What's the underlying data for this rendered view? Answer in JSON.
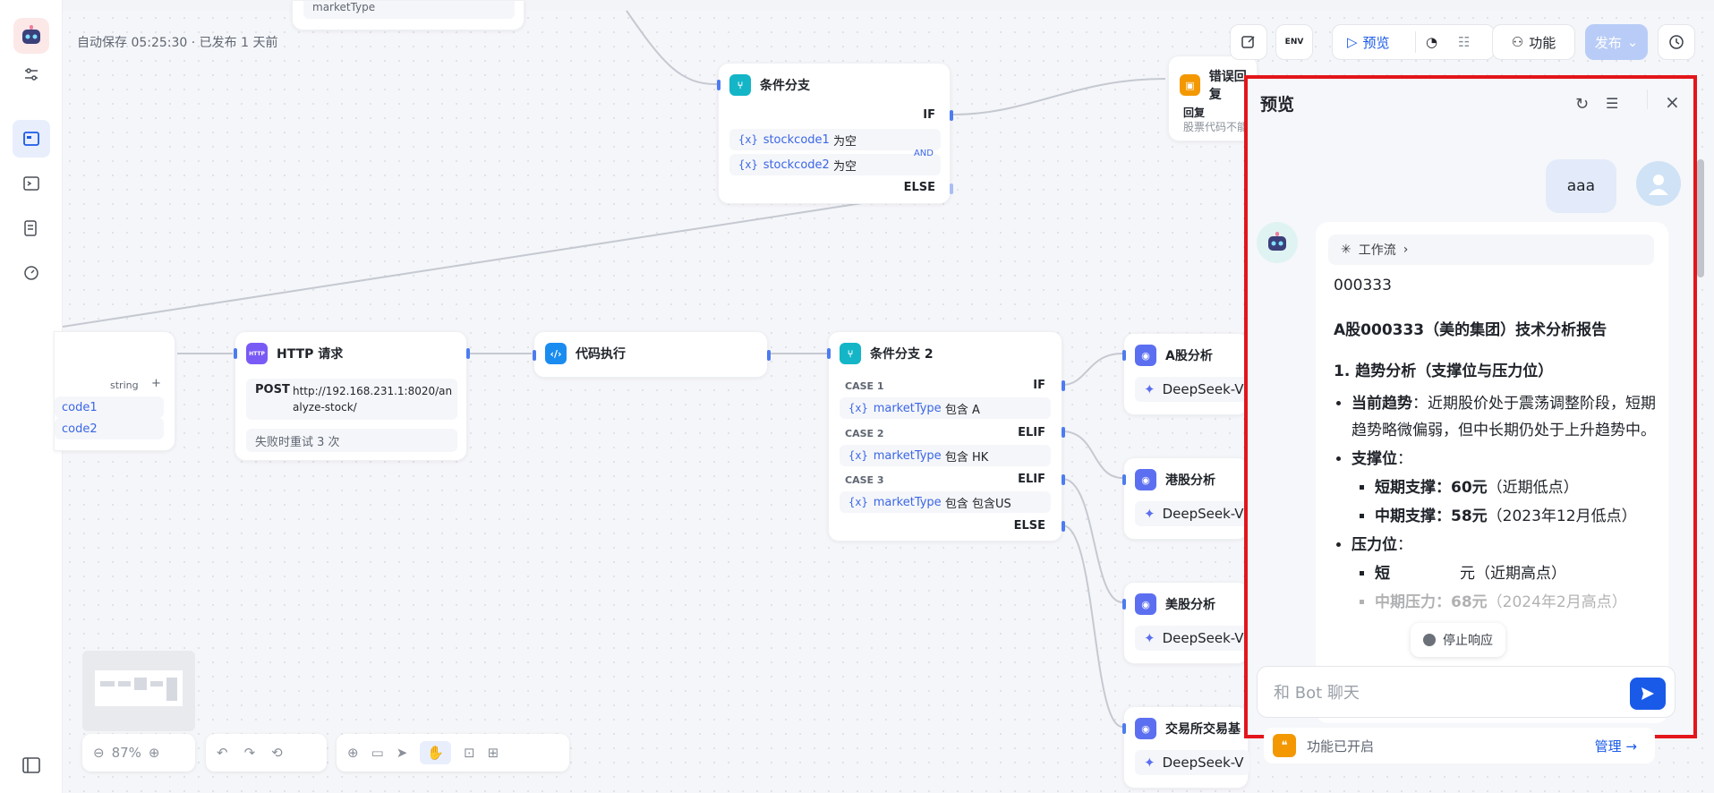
{
  "header": {
    "autosave": "自动保存 05:25:30 · 已发布 1 天前",
    "preview_label": "预览",
    "function_label": "功能",
    "publish_label": "发布",
    "env_label": "ENV"
  },
  "nodes": {
    "top_partial": {
      "text": "marketType"
    },
    "condition1": {
      "title": "条件分支",
      "if_label": "IF",
      "else_label": "ELSE",
      "and_label": "AND",
      "rows": [
        {
          "var": "{x}",
          "name": "stockcode1",
          "op": "为空"
        },
        {
          "var": "{x}",
          "name": "stockcode2",
          "op": "为空"
        }
      ]
    },
    "error_reply": {
      "title": "错误回复",
      "label": "回复",
      "text": "股票代码不能为空，请重新输入！"
    },
    "start_partial": {
      "type": "string",
      "plus": "+",
      "row1": "code1",
      "row2": "code2"
    },
    "http": {
      "title": "HTTP 请求",
      "icon_text": "HTTP",
      "method": "POST",
      "url": "http://192.168.231.1:8020/analyze-stock/",
      "retry": "失败时重试 3 次"
    },
    "code": {
      "title": "代码执行"
    },
    "condition2": {
      "title": "条件分支 2",
      "cases": [
        {
          "case": "CASE 1",
          "branch": "IF",
          "var": "{x}",
          "name": "marketType",
          "op": "包含 A"
        },
        {
          "case": "CASE 2",
          "branch": "ELIF",
          "var": "{x}",
          "name": "marketType",
          "op": "包含 HK"
        },
        {
          "case": "CASE 3",
          "branch": "ELIF",
          "var": "{x}",
          "name": "marketType",
          "op": "包含 包含US"
        }
      ],
      "else_label": "ELSE"
    },
    "llm": [
      {
        "title": "A股分析",
        "model": "DeepSeek-V"
      },
      {
        "title": "港股分析",
        "model": "DeepSeek-V"
      },
      {
        "title": "美股分析",
        "model": "DeepSeek-V"
      },
      {
        "title": "交易所交易基",
        "model": "DeepSeek-V"
      }
    ]
  },
  "controls": {
    "zoom": "87%"
  },
  "preview": {
    "title": "预览",
    "user_message": "aaa",
    "workflow_chip": "工作流",
    "stock_code": "000333",
    "report_title": "A股000333（美的集团）技术分析报告",
    "section1": "1. 趋势分析（支撑位与压力位）",
    "trend_label": "当前趋势",
    "trend_text": "：近期股价处于震荡调整阶段，短期趋势略微偏弱，但中长期仍处于上升趋势中。",
    "support_label": "支撑位",
    "support_suffix": "：",
    "short_support_label": "短期支撑",
    "short_support_value": "：60元",
    "short_support_note": "（近期低点）",
    "mid_support_label": "中期支撑",
    "mid_support_value": "：58元",
    "mid_support_note": "（2023年12月低点）",
    "pressure_label": "压力位",
    "pressure_suffix": "：",
    "short_pressure_label": "短",
    "short_pressure_note": "元（近期高点）",
    "mid_pressure_label": "中期压力",
    "mid_pressure_value": "：68元",
    "mid_pressure_note": "（2024年2月高点）",
    "stop_label": "停止响应",
    "input_placeholder": "和 Bot 聊天",
    "feature_status": "功能已开启",
    "manage_label": "管理 →"
  }
}
